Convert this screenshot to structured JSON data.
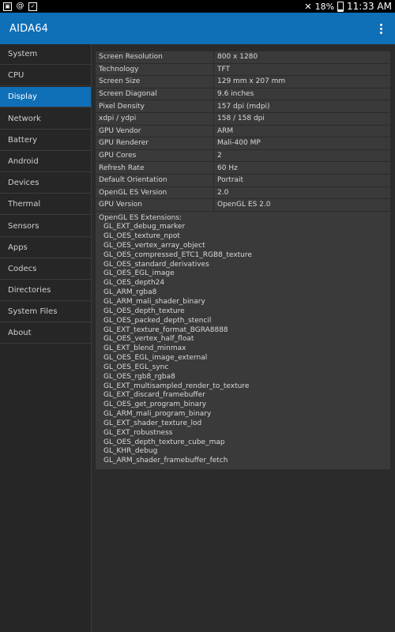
{
  "statusbar": {
    "battery": "18%",
    "time": "11:33 AM"
  },
  "app": {
    "title": "AIDA64"
  },
  "sidebar": {
    "items": [
      {
        "label": "System"
      },
      {
        "label": "CPU"
      },
      {
        "label": "Display"
      },
      {
        "label": "Network"
      },
      {
        "label": "Battery"
      },
      {
        "label": "Android"
      },
      {
        "label": "Devices"
      },
      {
        "label": "Thermal"
      },
      {
        "label": "Sensors"
      },
      {
        "label": "Apps"
      },
      {
        "label": "Codecs"
      },
      {
        "label": "Directories"
      },
      {
        "label": "System Files"
      },
      {
        "label": "About"
      }
    ],
    "active": "Display"
  },
  "display": {
    "rows": [
      {
        "key": "Screen Resolution",
        "value": "800 x 1280"
      },
      {
        "key": "Technology",
        "value": "TFT"
      },
      {
        "key": "Screen Size",
        "value": "129 mm x 207 mm"
      },
      {
        "key": "Screen Diagonal",
        "value": "9.6 inches"
      },
      {
        "key": "Pixel Density",
        "value": "157 dpi (mdpi)"
      },
      {
        "key": "xdpi / ydpi",
        "value": "158 / 158 dpi"
      },
      {
        "key": "GPU Vendor",
        "value": "ARM"
      },
      {
        "key": "GPU Renderer",
        "value": "Mali-400 MP"
      },
      {
        "key": "GPU Cores",
        "value": "2"
      },
      {
        "key": "Refresh Rate",
        "value": "60 Hz"
      },
      {
        "key": "Default Orientation",
        "value": "Portrait"
      },
      {
        "key": "OpenGL ES Version",
        "value": "2.0"
      },
      {
        "key": "GPU Version",
        "value": "OpenGL ES 2.0"
      }
    ],
    "extensions_title": "OpenGL ES Extensions:",
    "extensions": [
      "GL_EXT_debug_marker",
      "GL_OES_texture_npot",
      "GL_OES_vertex_array_object",
      "GL_OES_compressed_ETC1_RGB8_texture",
      "GL_OES_standard_derivatives",
      "GL_OES_EGL_image",
      "GL_OES_depth24",
      "GL_ARM_rgba8",
      "GL_ARM_mali_shader_binary",
      "GL_OES_depth_texture",
      "GL_OES_packed_depth_stencil",
      "GL_EXT_texture_format_BGRA8888",
      "GL_OES_vertex_half_float",
      "GL_EXT_blend_minmax",
      "GL_OES_EGL_image_external",
      "GL_OES_EGL_sync",
      "GL_OES_rgb8_rgba8",
      "GL_EXT_multisampled_render_to_texture",
      "GL_EXT_discard_framebuffer",
      "GL_OES_get_program_binary",
      "GL_ARM_mali_program_binary",
      "GL_EXT_shader_texture_lod",
      "GL_EXT_robustness",
      "GL_OES_depth_texture_cube_map",
      "GL_KHR_debug",
      "GL_ARM_shader_framebuffer_fetch"
    ]
  }
}
